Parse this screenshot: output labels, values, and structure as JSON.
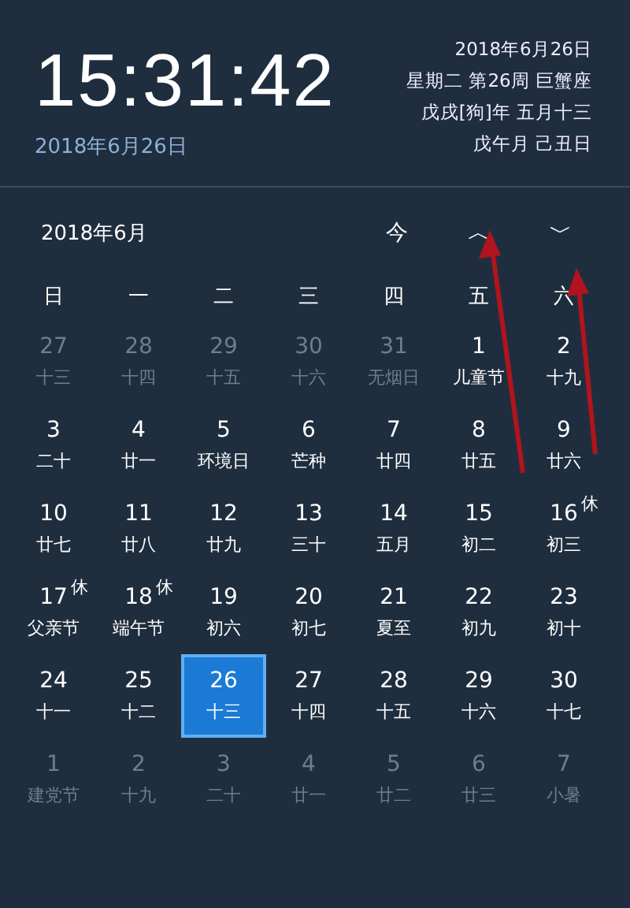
{
  "clock": {
    "time": "15:31:42",
    "date": "2018年6月26日"
  },
  "info": [
    "2018年6月26日",
    "星期二 第26周 巨蟹座",
    "戊戌[狗]年 五月十三",
    "戊午月 己丑日"
  ],
  "nav": {
    "month": "2018年6月",
    "today": "今",
    "prev": "︿",
    "next": "﹀"
  },
  "weekdays": [
    "日",
    "一",
    "二",
    "三",
    "四",
    "五",
    "六"
  ],
  "weeks": [
    [
      {
        "day": "27",
        "lunar": "十三",
        "in_month": false,
        "selected": false
      },
      {
        "day": "28",
        "lunar": "十四",
        "in_month": false,
        "selected": false
      },
      {
        "day": "29",
        "lunar": "十五",
        "in_month": false,
        "selected": false
      },
      {
        "day": "30",
        "lunar": "十六",
        "in_month": false,
        "selected": false
      },
      {
        "day": "31",
        "lunar": "无烟日",
        "in_month": false,
        "selected": false
      },
      {
        "day": "1",
        "lunar": "儿童节",
        "in_month": true,
        "selected": false
      },
      {
        "day": "2",
        "lunar": "十九",
        "in_month": true,
        "selected": false
      }
    ],
    [
      {
        "day": "3",
        "lunar": "二十",
        "in_month": true,
        "selected": false
      },
      {
        "day": "4",
        "lunar": "廿一",
        "in_month": true,
        "selected": false
      },
      {
        "day": "5",
        "lunar": "环境日",
        "in_month": true,
        "selected": false
      },
      {
        "day": "6",
        "lunar": "芒种",
        "in_month": true,
        "selected": false
      },
      {
        "day": "7",
        "lunar": "廿四",
        "in_month": true,
        "selected": false
      },
      {
        "day": "8",
        "lunar": "廿五",
        "in_month": true,
        "selected": false
      },
      {
        "day": "9",
        "lunar": "廿六",
        "in_month": true,
        "selected": false
      }
    ],
    [
      {
        "day": "10",
        "lunar": "廿七",
        "in_month": true,
        "selected": false
      },
      {
        "day": "11",
        "lunar": "廿八",
        "in_month": true,
        "selected": false
      },
      {
        "day": "12",
        "lunar": "廿九",
        "in_month": true,
        "selected": false
      },
      {
        "day": "13",
        "lunar": "三十",
        "in_month": true,
        "selected": false
      },
      {
        "day": "14",
        "lunar": "五月",
        "in_month": true,
        "selected": false
      },
      {
        "day": "15",
        "lunar": "初二",
        "in_month": true,
        "selected": false
      },
      {
        "day": "16",
        "lunar": "初三",
        "in_month": true,
        "selected": false,
        "badge": "休"
      }
    ],
    [
      {
        "day": "17",
        "lunar": "父亲节",
        "in_month": true,
        "selected": false,
        "badge": "休"
      },
      {
        "day": "18",
        "lunar": "端午节",
        "in_month": true,
        "selected": false,
        "badge": "休"
      },
      {
        "day": "19",
        "lunar": "初六",
        "in_month": true,
        "selected": false
      },
      {
        "day": "20",
        "lunar": "初七",
        "in_month": true,
        "selected": false
      },
      {
        "day": "21",
        "lunar": "夏至",
        "in_month": true,
        "selected": false
      },
      {
        "day": "22",
        "lunar": "初九",
        "in_month": true,
        "selected": false
      },
      {
        "day": "23",
        "lunar": "初十",
        "in_month": true,
        "selected": false
      }
    ],
    [
      {
        "day": "24",
        "lunar": "十一",
        "in_month": true,
        "selected": false
      },
      {
        "day": "25",
        "lunar": "十二",
        "in_month": true,
        "selected": false
      },
      {
        "day": "26",
        "lunar": "十三",
        "in_month": true,
        "selected": true
      },
      {
        "day": "27",
        "lunar": "十四",
        "in_month": true,
        "selected": false
      },
      {
        "day": "28",
        "lunar": "十五",
        "in_month": true,
        "selected": false
      },
      {
        "day": "29",
        "lunar": "十六",
        "in_month": true,
        "selected": false
      },
      {
        "day": "30",
        "lunar": "十七",
        "in_month": true,
        "selected": false
      }
    ],
    [
      {
        "day": "1",
        "lunar": "建党节",
        "in_month": false,
        "selected": false
      },
      {
        "day": "2",
        "lunar": "十九",
        "in_month": false,
        "selected": false
      },
      {
        "day": "3",
        "lunar": "二十",
        "in_month": false,
        "selected": false
      },
      {
        "day": "4",
        "lunar": "廿一",
        "in_month": false,
        "selected": false
      },
      {
        "day": "5",
        "lunar": "廿二",
        "in_month": false,
        "selected": false
      },
      {
        "day": "6",
        "lunar": "廿三",
        "in_month": false,
        "selected": false
      },
      {
        "day": "7",
        "lunar": "小暑",
        "in_month": false,
        "selected": false
      }
    ]
  ],
  "annotations": [
    {
      "kind": "arrow"
    },
    {
      "kind": "arrow"
    }
  ]
}
